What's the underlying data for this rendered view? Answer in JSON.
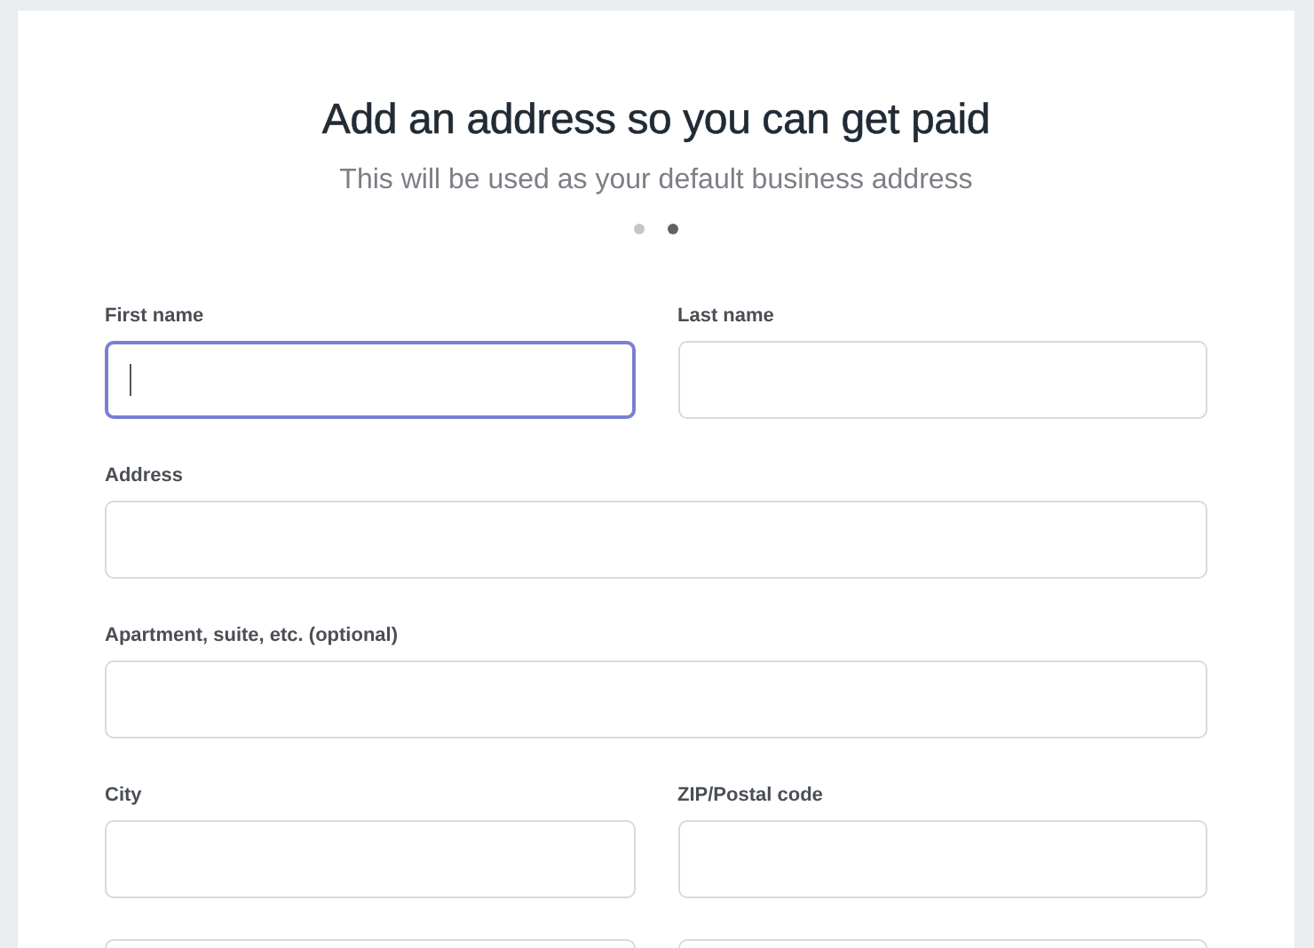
{
  "title": "Add an address so you can get paid",
  "subtitle": "This will be used as your default business address",
  "steps": [
    {
      "selected": false
    },
    {
      "selected": true
    }
  ],
  "form_rows": [
    {
      "fields": [
        {
          "label": "First name",
          "focused": true
        },
        {
          "label": "Last name",
          "focused": false
        }
      ]
    },
    {
      "fields": [
        {
          "label": "Address",
          "focused": false
        }
      ]
    },
    {
      "fields": [
        {
          "label": "Apartment, suite, etc. (optional)",
          "focused": false
        }
      ]
    },
    {
      "fields": [
        {
          "label": "City",
          "focused": false
        },
        {
          "label": "ZIP/Postal code",
          "focused": false
        }
      ]
    },
    {
      "fields": [
        {
          "focused": false
        },
        {
          "focused": false
        }
      ]
    }
  ]
}
